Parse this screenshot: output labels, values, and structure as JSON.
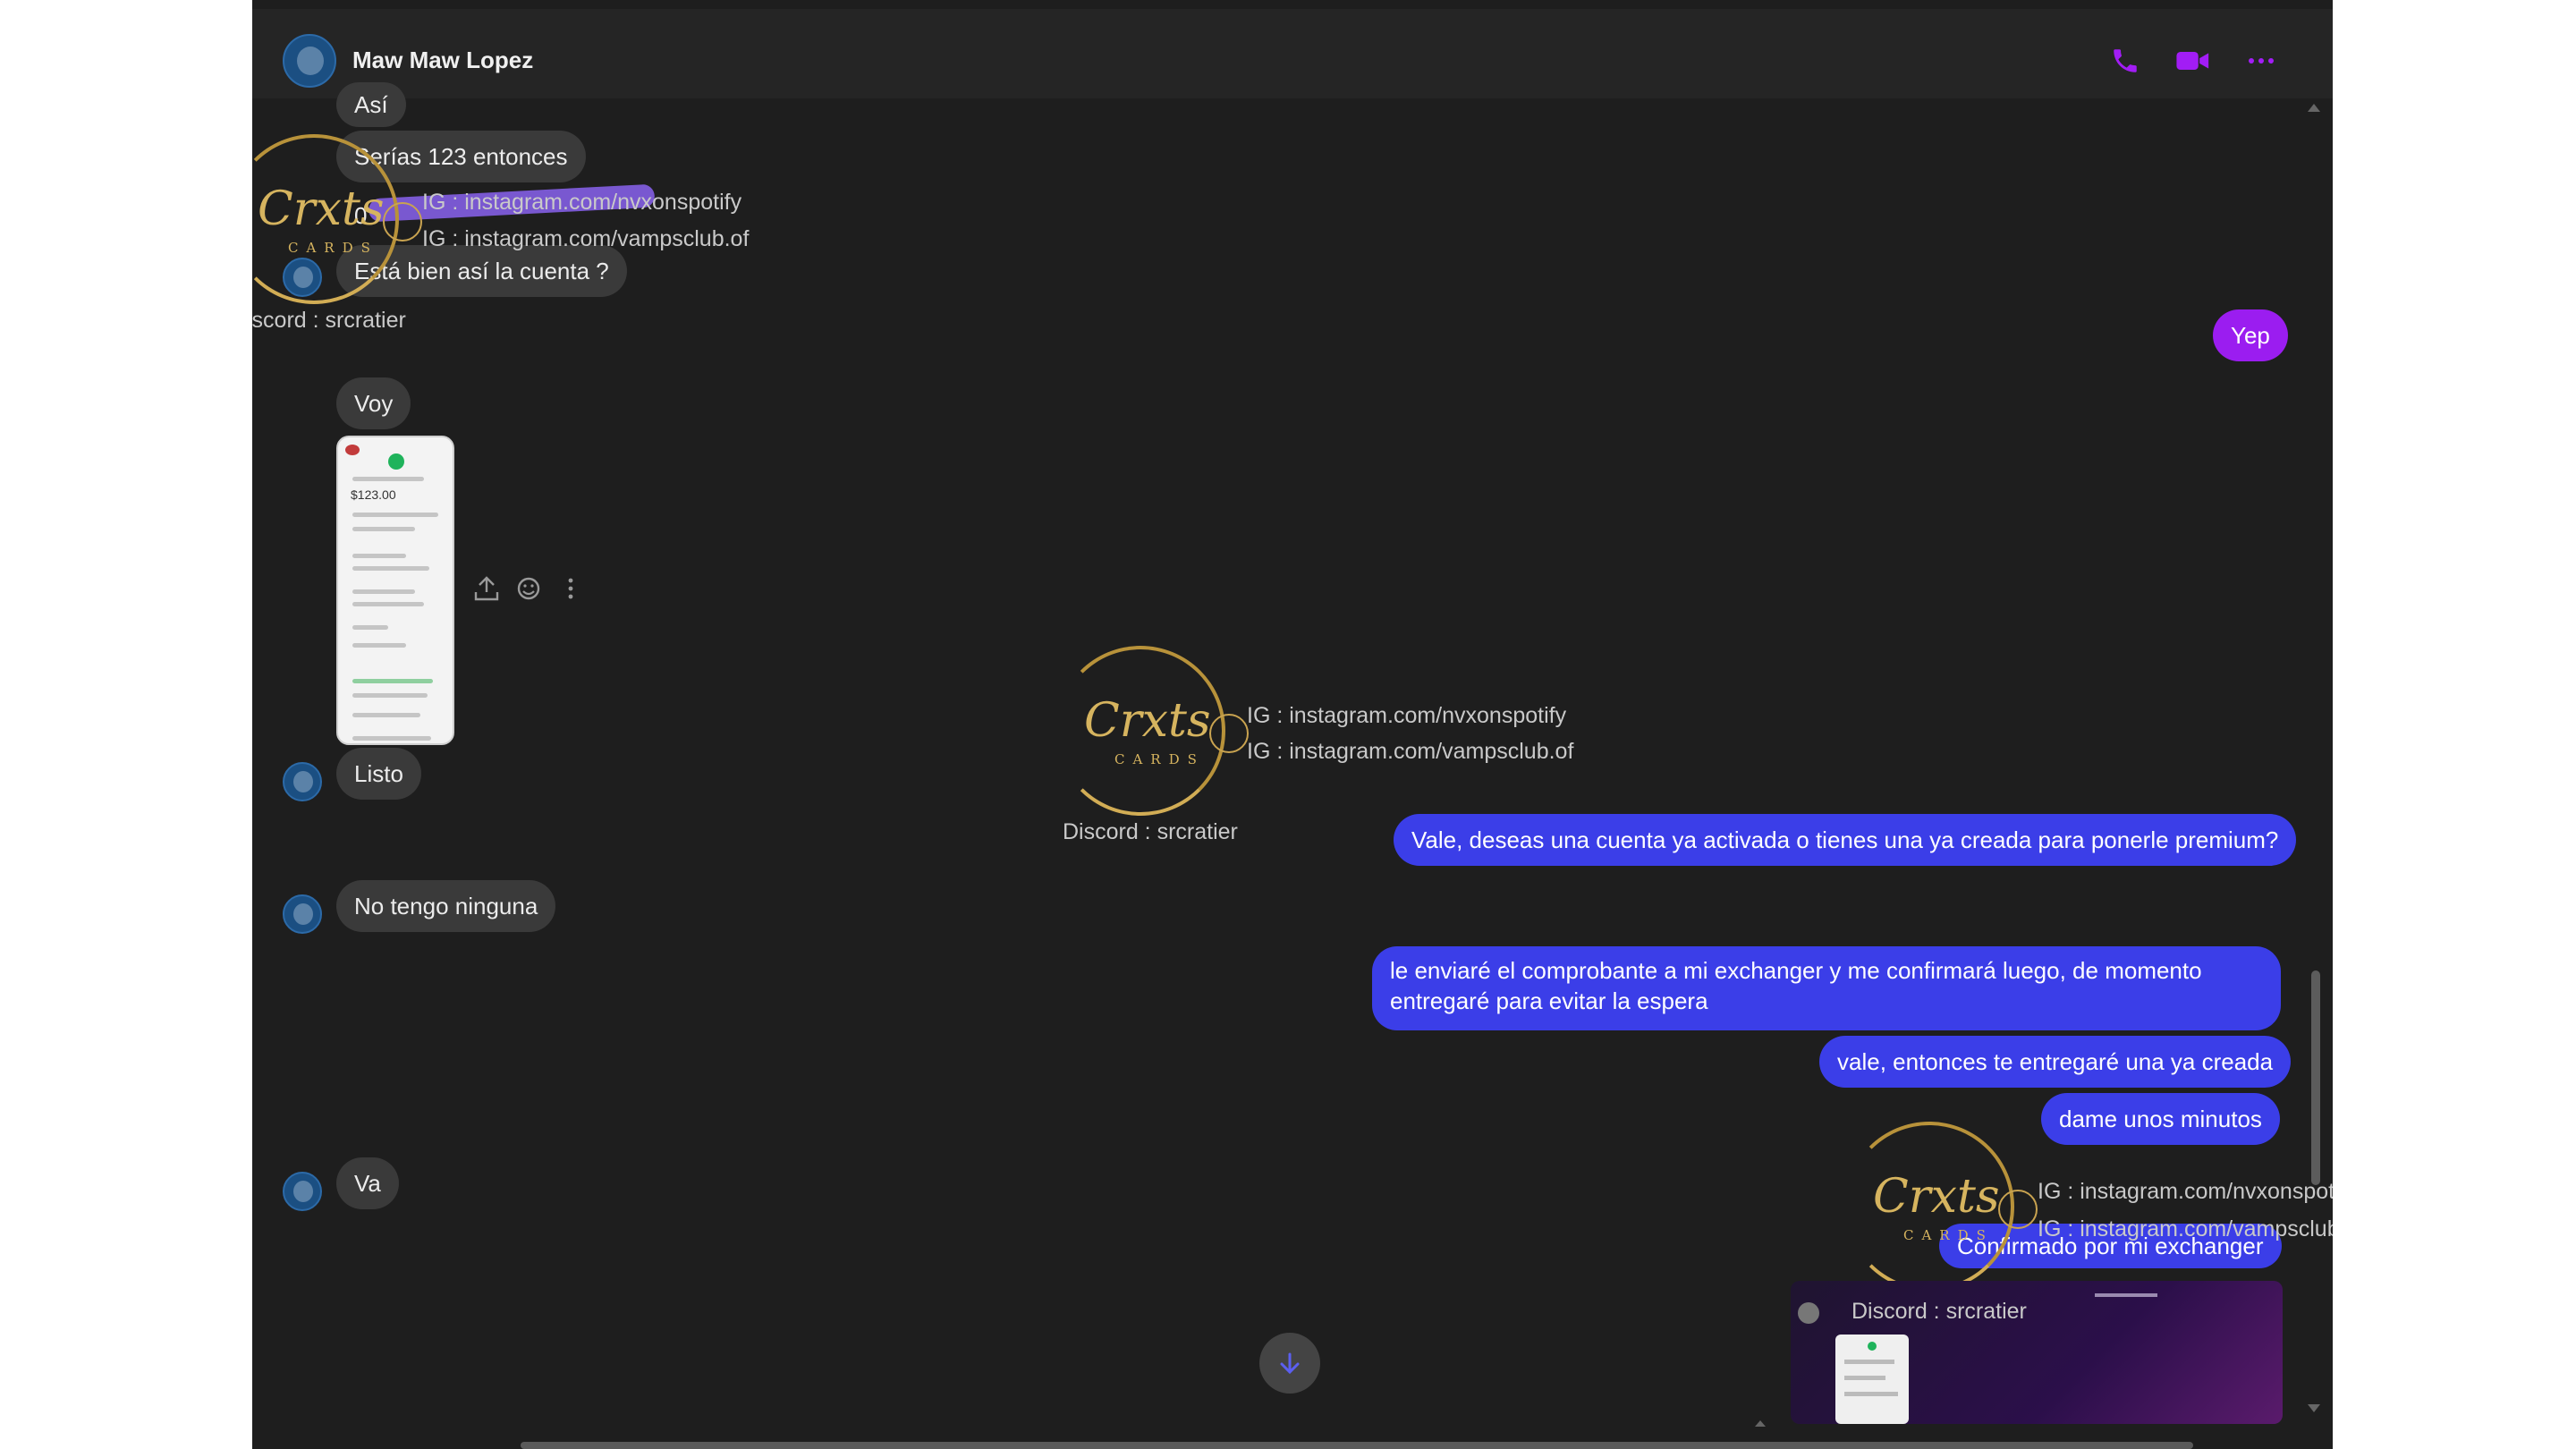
{
  "header": {
    "contact_name": "Maw Maw Lopez",
    "icons": [
      "phone-icon",
      "video-camera-icon",
      "more-options-icon"
    ],
    "accent_color": "#a21df5"
  },
  "messages": {
    "in_asi": "Así",
    "in_serias": "Serías 123 entonces",
    "in_number_partial": "0",
    "in_cuenta": "Está bien así la cuenta ?",
    "out_yep": "Yep",
    "in_voy": "Voy",
    "in_listo": "Listo",
    "out_vale_deseas": "Vale, deseas una cuenta ya activada o tienes una ya creada para ponerle premium?",
    "in_no_tengo": "No tengo ninguna",
    "out_enviare": "le enviaré el comprobante a mi exchanger y me confirmará luego, de momento entregaré para evitar la espera",
    "out_vale_entonces": "vale, entonces te entregaré una ya creada",
    "out_dame": "dame unos minutos",
    "in_va": "Va",
    "out_confirmado": "Confirmado por mi exchanger"
  },
  "receipt_thumb": {
    "amount": "$123.00"
  },
  "watermark": {
    "logo_script": "Crxts",
    "logo_sub": "CARDS",
    "ig1": "IG : instagram.com/nvxonspotify",
    "ig2": "IG : instagram.com/vampsclub.of",
    "discord": "Discord : srcratier",
    "discord_partial": "iscord : srcratier",
    "ig1_partial": "IG : instagram.com/nvxonspoti",
    "ig2_partial": "IG : instagram.com/vampsclub.o"
  },
  "colors": {
    "outgoing_bubble": "#3b3ee8",
    "incoming_bubble": "#3a3a3a",
    "background": "#1e1e1e"
  }
}
